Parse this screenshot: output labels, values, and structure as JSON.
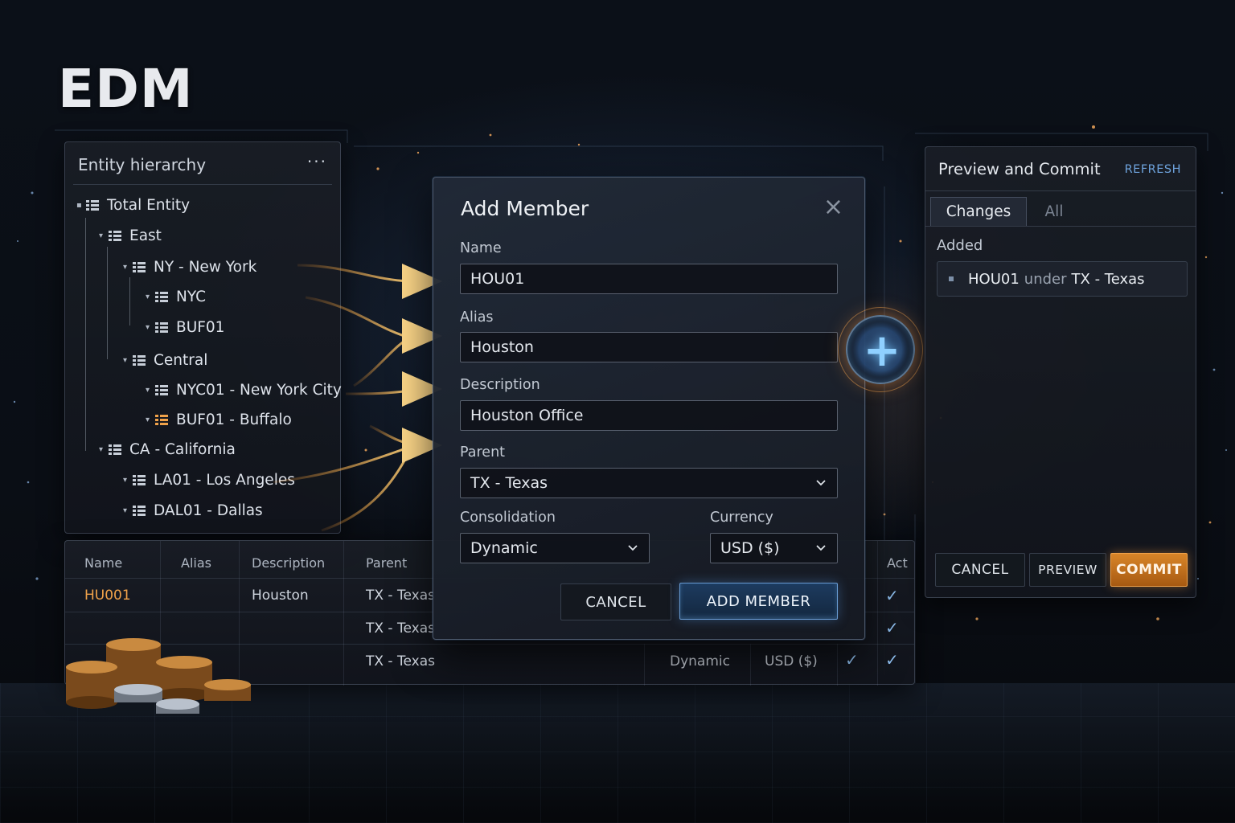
{
  "brand": {
    "title": "EDM"
  },
  "hierarchy": {
    "title": "Entity hierarchy",
    "menu": "···",
    "items": [
      {
        "label": "Total Entity"
      },
      {
        "label": "East"
      },
      {
        "label": "NY - New York"
      },
      {
        "label": "NYC"
      },
      {
        "label": "BUF01"
      },
      {
        "label": "Central"
      },
      {
        "label": "NYC01 - New York City"
      },
      {
        "label": "BUF01 - Buffalo"
      },
      {
        "label": "CA - California"
      },
      {
        "label": "LA01 - Los Angeles"
      },
      {
        "label": "DAL01 - Dallas"
      }
    ]
  },
  "table": {
    "headers": [
      "Name",
      "Alias",
      "Description",
      "Parent",
      "Act"
    ],
    "rows": [
      {
        "name": "HU001",
        "alias": "",
        "description": "Houston",
        "parent": "TX - Texas",
        "consolidation": "",
        "currency": ""
      },
      {
        "name": "",
        "alias": "",
        "description": "",
        "parent": "TX - Texas",
        "consolidation": "",
        "currency": ""
      },
      {
        "name": "",
        "alias": "",
        "description": "",
        "parent": "TX - Texas",
        "consolidation": "Dynamic",
        "currency": "USD ($)"
      }
    ],
    "check": "✓"
  },
  "dialog": {
    "title": "Add Member",
    "close": "×",
    "name_label": "Name",
    "name_value": "HOU01",
    "alias_label": "Alias",
    "alias_value": "Houston",
    "description_label": "Description",
    "description_value": "Houston Office",
    "parent_label": "Parent",
    "parent_value": "TX - Texas",
    "consolidation_label": "Consolidation",
    "consolidation_value": "Dynamic",
    "currency_label": "Currency",
    "currency_value": "USD ($)",
    "cancel_label": "CANCEL",
    "add_label": "ADD MEMBER"
  },
  "preview": {
    "title": "Preview and Commit",
    "refresh": "REFRESH",
    "tabs": [
      {
        "label": "Changes"
      },
      {
        "label": "All"
      }
    ],
    "added_label": "Added",
    "change": {
      "member": "HOU01",
      "under": "under",
      "parent": "TX - Texas"
    },
    "cancel_label": "CANCEL",
    "preview_label": "PREVIEW",
    "commit_label": "COMMIT"
  },
  "colors": {
    "accent_orange": "#f0a24a",
    "accent_blue": "#6fa4de",
    "background": "#0a0e15"
  },
  "icons": [
    "grid-icon",
    "caret-down-icon",
    "close-icon",
    "chevron-down-icon",
    "plus-icon",
    "check-icon",
    "more-icon",
    "bullet-icon"
  ]
}
